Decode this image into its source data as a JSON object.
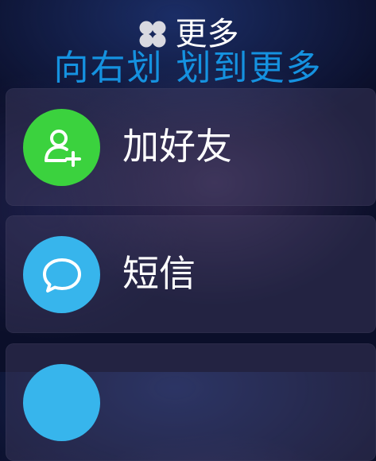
{
  "header": {
    "title": "更多",
    "icon": "four-petal-icon"
  },
  "hint": "向右划 划到更多",
  "items": [
    {
      "label": "加好友",
      "icon": "add-friend-icon",
      "color": "#3bd23e"
    },
    {
      "label": "短信",
      "icon": "message-bubble-icon",
      "color": "#37b5ec"
    },
    {
      "label": "",
      "icon": "partial-icon",
      "color": "#37b5ec"
    }
  ]
}
